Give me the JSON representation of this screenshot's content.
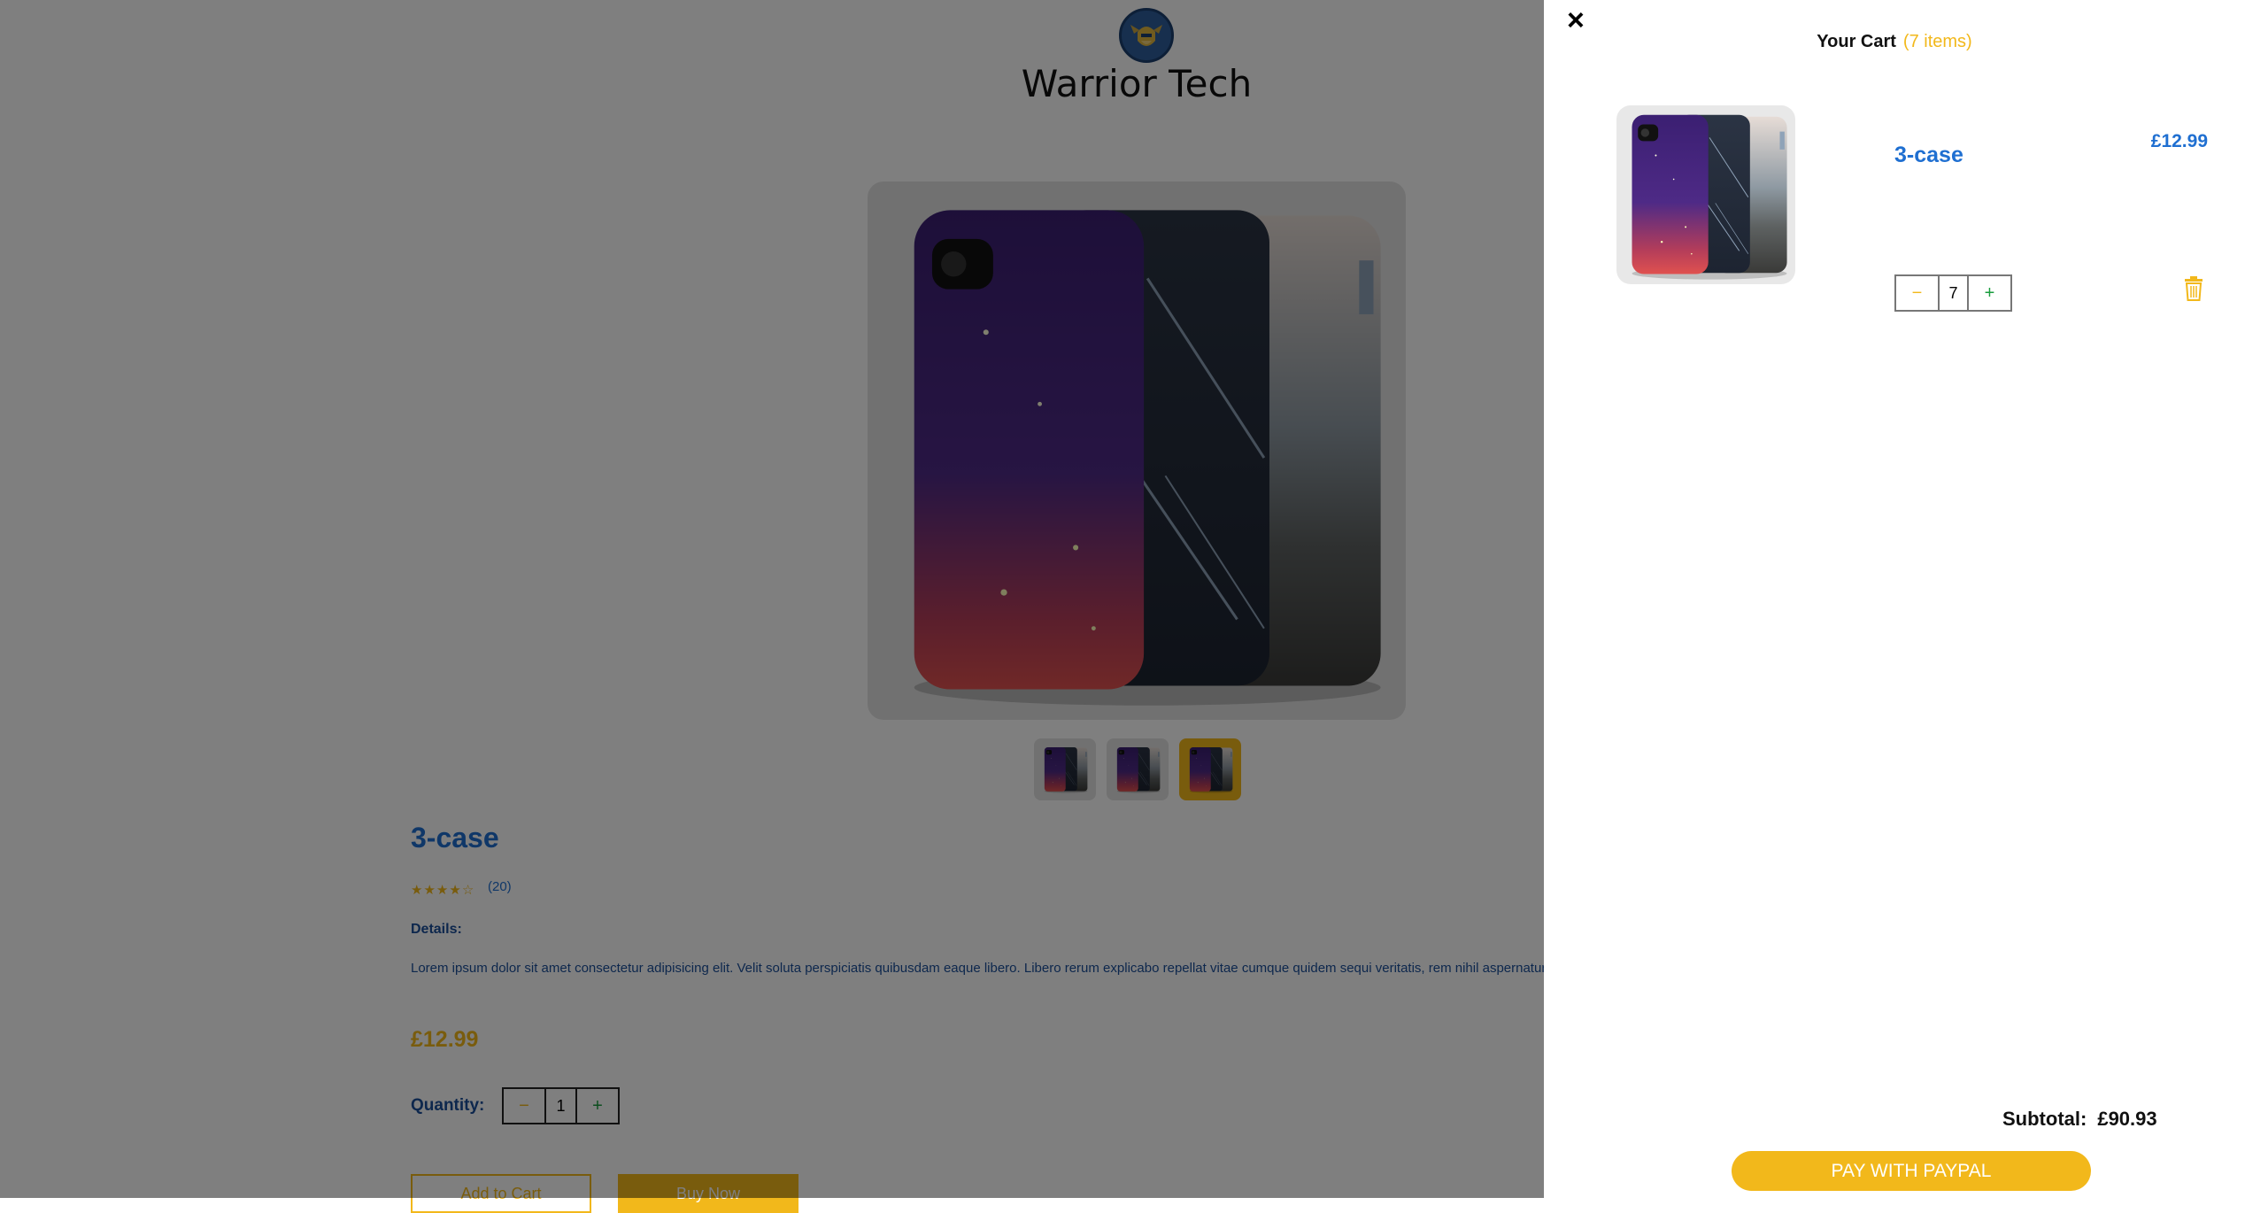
{
  "brand": {
    "name": "Warrior Tech"
  },
  "product": {
    "title": "3-case",
    "rating": 4,
    "rating_max": 5,
    "review_count": "(20)",
    "details_label": "Details:",
    "details_text": "Lorem ipsum dolor sit amet consectetur adipisicing elit. Velit soluta perspiciatis quibusdam eaque libero. Libero rerum explicabo repellat vitae cumque quidem sequi veritatis, rem nihil aspernatur!",
    "price": "£12.99",
    "quantity_label": "Quantity:",
    "quantity": "1",
    "minus": "−",
    "plus": "+",
    "add_to_cart": "Add to Cart",
    "buy_now": "Buy Now",
    "thumbnails_count": 3,
    "active_thumbnail": 3
  },
  "cart": {
    "close": "×",
    "title": "Your Cart",
    "count": "(7 items)",
    "items": [
      {
        "name": "3-case",
        "price": "£12.99",
        "quantity": "7",
        "minus": "−",
        "plus": "+"
      }
    ],
    "subtotal_label": "Subtotal:",
    "subtotal_value": "£90.93",
    "pay_button": "PAY WITH PAYPAL"
  },
  "colors": {
    "accent": "#f2b81b",
    "primary": "#1f6fd1",
    "overlay": "rgba(0,0,0,0.5)"
  },
  "icons": {
    "close": "close-icon",
    "trash": "trash-icon",
    "star": "star-icon",
    "logo": "warrior-helmet-logo"
  }
}
